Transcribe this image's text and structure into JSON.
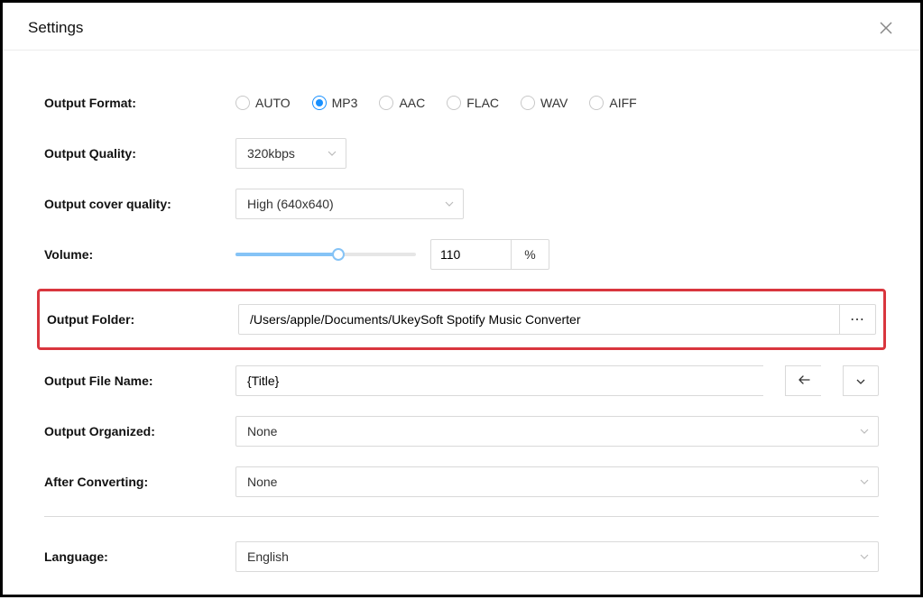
{
  "header": {
    "title": "Settings"
  },
  "labels": {
    "output_format": "Output Format:",
    "output_quality": "Output Quality:",
    "output_cover_quality": "Output cover quality:",
    "volume": "Volume:",
    "output_folder": "Output Folder:",
    "output_file_name": "Output File Name:",
    "output_organized": "Output Organized:",
    "after_converting": "After Converting:",
    "language": "Language:"
  },
  "output_format": {
    "options": [
      "AUTO",
      "MP3",
      "AAC",
      "FLAC",
      "WAV",
      "AIFF"
    ],
    "selected": "MP3"
  },
  "output_quality": {
    "value": "320kbps"
  },
  "output_cover_quality": {
    "value": "High (640x640)"
  },
  "volume": {
    "value": "110",
    "unit": "%",
    "slider_percent": 57
  },
  "output_folder": {
    "path": "/Users/apple/Documents/UkeySoft Spotify Music Converter"
  },
  "output_file_name": {
    "value": "{Title}"
  },
  "output_organized": {
    "value": "None"
  },
  "after_converting": {
    "value": "None"
  },
  "language": {
    "value": "English"
  }
}
